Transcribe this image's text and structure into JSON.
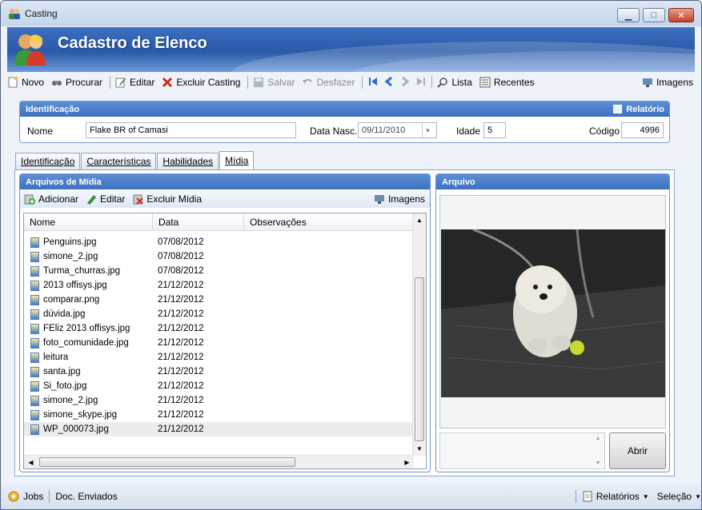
{
  "window": {
    "title": "Casting"
  },
  "banner": {
    "title": "Cadastro de Elenco"
  },
  "toolbar": {
    "novo": "Novo",
    "procurar": "Procurar",
    "editar": "Editar",
    "excluir": "Excluir Casting",
    "salvar": "Salvar",
    "desfazer": "Desfazer",
    "lista": "Lista",
    "recentes": "Recentes",
    "imagens": "Imagens"
  },
  "identificacao": {
    "header": "Identificação",
    "relatorio": "Relatório",
    "nome_label": "Nome",
    "nome_value": "Flake BR of Camasi",
    "data_label": "Data Nasc.",
    "data_value": "09/11/2010",
    "idade_label": "Idade",
    "idade_value": "5",
    "codigo_label": "Código",
    "codigo_value": "4996"
  },
  "tabs": [
    "Identificação",
    "Características",
    "Habilidades",
    "Mídia"
  ],
  "midia": {
    "header": "Arquivos de Mídia",
    "adicionar": "Adicionar",
    "editar": "Editar",
    "excluir": "Excluir Mídia",
    "imagens": "Imagens",
    "columns": [
      "Nome",
      "Data",
      "Observações"
    ],
    "rows": [
      {
        "nome": "Penguins.jpg",
        "data": "07/08/2012"
      },
      {
        "nome": "simone_2.jpg",
        "data": "07/08/2012"
      },
      {
        "nome": "Turma_churras.jpg",
        "data": "07/08/2012"
      },
      {
        "nome": "2013 offisys.jpg",
        "data": "21/12/2012"
      },
      {
        "nome": "comparar.png",
        "data": "21/12/2012"
      },
      {
        "nome": "dúvida.jpg",
        "data": "21/12/2012"
      },
      {
        "nome": "FEliz 2013 offisys.jpg",
        "data": "21/12/2012"
      },
      {
        "nome": "foto_comunidade.jpg",
        "data": "21/12/2012"
      },
      {
        "nome": "leitura",
        "data": "21/12/2012"
      },
      {
        "nome": "santa.jpg",
        "data": "21/12/2012"
      },
      {
        "nome": "Si_foto.jpg",
        "data": "21/12/2012"
      },
      {
        "nome": "simone_2.jpg",
        "data": "21/12/2012"
      },
      {
        "nome": "simone_skype.jpg",
        "data": "21/12/2012"
      },
      {
        "nome": "WP_000073.jpg",
        "data": "21/12/2012"
      }
    ]
  },
  "arquivo": {
    "header": "Arquivo",
    "abrir": "Abrir"
  },
  "bottom": {
    "jobs": "Jobs",
    "docs": "Doc. Enviados",
    "relatorios": "Relatórios",
    "selecao": "Seleção"
  },
  "colors": {
    "accent": "#3d70be",
    "banner": "#2a5aa8"
  }
}
